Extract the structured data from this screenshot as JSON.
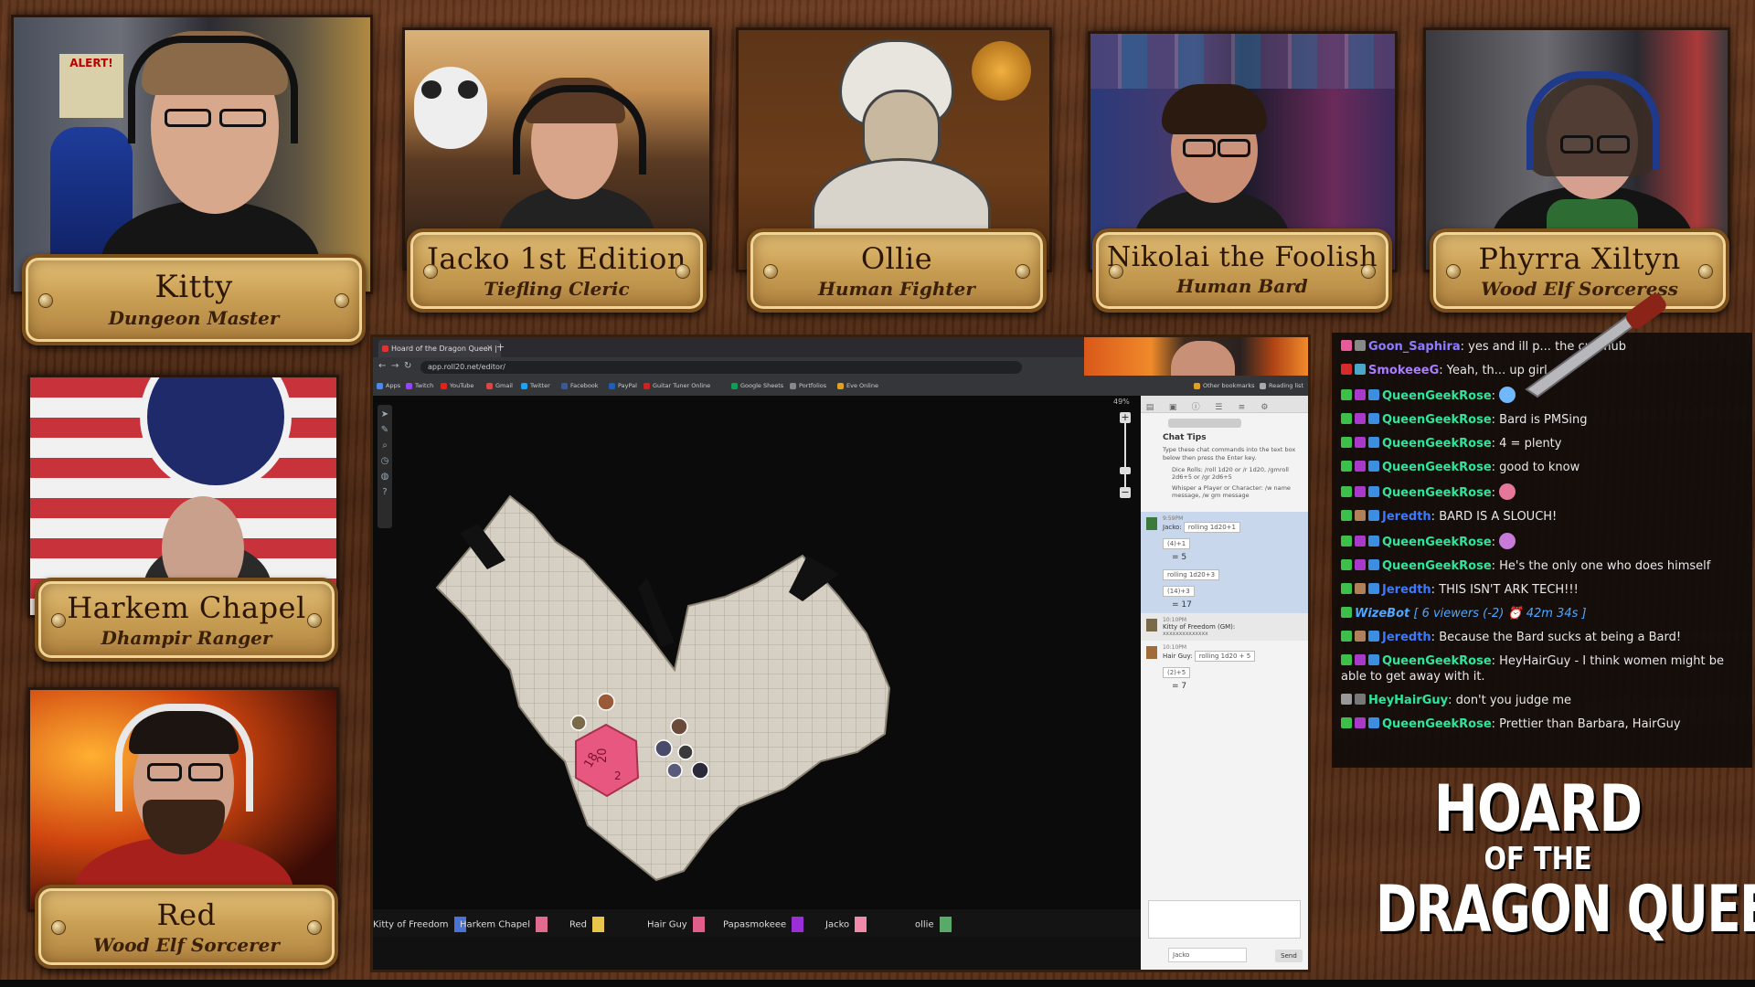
{
  "players": [
    {
      "name": "Kitty",
      "role": "Dungeon Master"
    },
    {
      "name": "Jacko 1st Edition",
      "role": "Tiefling Cleric"
    },
    {
      "name": "Ollie",
      "role": "Human Fighter"
    },
    {
      "name": "Nikolai the Foolish",
      "role": "Human Bard"
    },
    {
      "name": "Phyrra Xiltyn",
      "role": "Wood Elf Sorceress"
    },
    {
      "name": "Harkem Chapel",
      "role": "Dhampir Ranger"
    },
    {
      "name": "Red",
      "role": "Wood Elf Sorcerer"
    }
  ],
  "cam_text": {
    "alert_sign": "ALERT!"
  },
  "browser": {
    "tab_title": "Hoard of the Dragon Queen | Ro...",
    "url": "app.roll20.net/editor/",
    "bookmarks": [
      "Apps",
      "Twitch",
      "YouTube",
      "Gmail",
      "Twitter",
      "Facebook",
      "PayPal",
      "Guitar Tuner Online",
      "Google Sheets",
      "Portfolios",
      "Eve Online",
      "Other bookmarks",
      "Reading list"
    ]
  },
  "vtt": {
    "zoom": "49%",
    "chat_tips_title": "Chat Tips",
    "chat_tips_text": "Type these chat commands into the text box below then press the Enter key.",
    "tips": [
      "Dice Rolls: /roll 1d20 or /r 1d20, /gmroll 2d6+5 or /gr 2d6+5",
      "Whisper a Player or Character: /w name message, /w gm message"
    ],
    "messages": [
      {
        "time": "9:59PM",
        "who": "Jacko:",
        "roll": "rolling 1d20+1",
        "dice": "(4)+1",
        "result": "5"
      },
      {
        "roll": "rolling 1d20+3",
        "dice": "(14)+3",
        "result": "17"
      },
      {
        "time": "10:10PM",
        "who": "Kitty of Freedom (GM):",
        "text": "xxxxxxxxxxxxxx"
      },
      {
        "time": "10:10PM",
        "who": "Hair Guy:",
        "roll": "rolling 1d20 + 5",
        "dice": "(2)+5",
        "result": "7"
      }
    ],
    "chat_as": "Jacko",
    "send": "Send",
    "die_faces": [
      "18",
      "20",
      "2"
    ],
    "player_bar": [
      {
        "name": "Kitty of Freedom",
        "color": "#4a73d8"
      },
      {
        "name": "Harkem Chapel",
        "color": "#e06b8e"
      },
      {
        "name": "Red",
        "color": "#e6c54a"
      },
      {
        "name": "Hair Guy",
        "color": "#e25d8a"
      },
      {
        "name": "Papasmokeee",
        "color": "#9a2fd8"
      },
      {
        "name": "Jacko",
        "color": "#f08aa8"
      },
      {
        "name": "ollie",
        "color": "#5aa86a"
      }
    ]
  },
  "chat": [
    {
      "user": "Goon_Saphira",
      "color": "#8f7dff",
      "text": "yes and ill p... the cub hub",
      "badges": [
        "#e95a9b",
        "#888"
      ]
    },
    {
      "user": "SmokeeeG",
      "color": "#a97dff",
      "text": "Yeah, th... up girl",
      "badges": [
        "#d62b2b",
        "#4aa7c9"
      ]
    },
    {
      "user": "QueenGeekRose",
      "color": "#2ee59d",
      "text": "",
      "emote": "#6fb7ff",
      "badges": [
        "#3cc04a",
        "#a93ac9",
        "#3b8ee0"
      ]
    },
    {
      "user": "QueenGeekRose",
      "color": "#2ee59d",
      "text": "Bard is PMSing",
      "badges": [
        "#3cc04a",
        "#a93ac9",
        "#3b8ee0"
      ]
    },
    {
      "user": "QueenGeekRose",
      "color": "#2ee59d",
      "text": "4 = plenty",
      "badges": [
        "#3cc04a",
        "#a93ac9",
        "#3b8ee0"
      ]
    },
    {
      "user": "QueenGeekRose",
      "color": "#2ee59d",
      "text": "good to know",
      "badges": [
        "#3cc04a",
        "#a93ac9",
        "#3b8ee0"
      ]
    },
    {
      "user": "QueenGeekRose",
      "color": "#2ee59d",
      "text": "",
      "emote": "#e6779a",
      "badges": [
        "#3cc04a",
        "#a93ac9",
        "#3b8ee0"
      ]
    },
    {
      "user": "Jeredth",
      "color": "#3b79ff",
      "text": "BARD IS A SLOUCH!",
      "badges": [
        "#3cc04a",
        "#b0805a",
        "#3b8ee0"
      ]
    },
    {
      "user": "QueenGeekRose",
      "color": "#2ee59d",
      "text": "",
      "emote": "#c87ad8",
      "badges": [
        "#3cc04a",
        "#a93ac9",
        "#3b8ee0"
      ]
    },
    {
      "user": "QueenGeekRose",
      "color": "#2ee59d",
      "text": "He's the only one who does himself",
      "badges": [
        "#3cc04a",
        "#a93ac9",
        "#3b8ee0"
      ]
    },
    {
      "user": "Jeredth",
      "color": "#3b79ff",
      "text": "THIS ISN'T ARK TECH!!!",
      "badges": [
        "#3cc04a",
        "#b0805a",
        "#3b8ee0"
      ]
    },
    {
      "user": "WizeBot",
      "color": "#4fa6ff",
      "text": "[ 6 viewers (-2) ⏰ 42m 34s ]",
      "italic": true,
      "badges": [
        "#3cc04a"
      ]
    },
    {
      "user": "Jeredth",
      "color": "#3b79ff",
      "text": "Because the Bard sucks at being a Bard!",
      "badges": [
        "#3cc04a",
        "#b0805a",
        "#3b8ee0"
      ]
    },
    {
      "user": "QueenGeekRose",
      "color": "#2ee59d",
      "text": "HeyHairGuy - I think women might be able to get away with it.",
      "badges": [
        "#3cc04a",
        "#a93ac9",
        "#3b8ee0"
      ]
    },
    {
      "user": "HeyHairGuy",
      "color": "#2ee59d",
      "text": "don't you judge me",
      "badges": [
        "#999",
        "#777"
      ]
    },
    {
      "user": "QueenGeekRose",
      "color": "#2ee59d",
      "text": "Prettier than Barbara, HairGuy",
      "badges": [
        "#3cc04a",
        "#a93ac9",
        "#3b8ee0"
      ]
    }
  ],
  "logo": {
    "line1": "HOARD",
    "line2": "OF THE",
    "line3": "DRAGON QUEEN"
  }
}
